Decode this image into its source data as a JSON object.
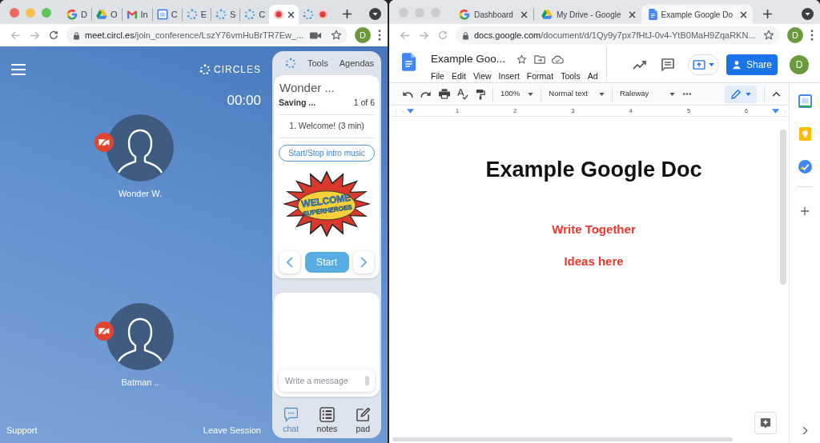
{
  "left_window": {
    "focused": true,
    "compact_tabs": true,
    "tabs": [
      {
        "kind": "google",
        "label": "D",
        "selected": false
      },
      {
        "kind": "drive",
        "label": "O",
        "selected": false
      },
      {
        "kind": "gmail",
        "label": "In",
        "selected": false
      },
      {
        "kind": "calendar",
        "label": "C",
        "selected": false
      },
      {
        "kind": "circles",
        "label": "E",
        "selected": false
      },
      {
        "kind": "circles",
        "label": "S",
        "selected": false
      },
      {
        "kind": "circles",
        "label": "C",
        "selected": false
      },
      {
        "kind": "recording",
        "selected": true
      },
      {
        "kind": "circles_recording",
        "selected": false
      }
    ],
    "address_bar": {
      "host": "meet.circl.es",
      "path": "/join_conference/LszY76vmHuBrTR7Ew_...",
      "camera_in_use": true,
      "avatar": "D"
    },
    "conference": {
      "logo": "CIRCLES",
      "timer": "00:00",
      "participants": [
        {
          "name": "Wonder W.",
          "camera_off": true
        },
        {
          "name": "Batman ..",
          "camera_off": true
        }
      ],
      "footer": [
        "Support",
        "Leave Session"
      ]
    },
    "circles_panel": {
      "nav": [
        "Tools",
        "Agendas"
      ],
      "agenda": {
        "title": "Wonder ...",
        "status": "Saving ...",
        "position": "1 of 6",
        "item": "1. Welcome! (3 min)",
        "music_button": "Start/Stop intro music",
        "banner": [
          "WELCOME",
          "SUPERHEROES"
        ],
        "start_button": "Start"
      },
      "chat": {
        "placeholder": "Write a message"
      },
      "bottom_tabs": [
        {
          "kind": "chat",
          "label": "chat",
          "selected": true
        },
        {
          "kind": "notes",
          "label": "notes",
          "selected": false
        },
        {
          "kind": "pad",
          "label": "pad",
          "selected": false
        }
      ]
    }
  },
  "right_window": {
    "focused": false,
    "tabs": [
      {
        "kind": "google",
        "label": "Dashboard",
        "selected": false
      },
      {
        "kind": "drive",
        "label": "My Drive - Google",
        "selected": false
      },
      {
        "kind": "docs",
        "label": "Example Google Do",
        "selected": true
      }
    ],
    "address_bar": {
      "host": "docs.google.com",
      "path": "/document/d/1Qy9y7px7fHtJ-0v4-YtB0MaH9ZqaRKN...",
      "avatar": "D"
    },
    "docs": {
      "title": "Example Goo...",
      "menu": [
        "File",
        "Edit",
        "View",
        "Insert",
        "Format",
        "Tools",
        "Ad"
      ],
      "share_button": "Share",
      "avatar": "D",
      "toolbar": {
        "zoom": "100%",
        "style": "Normal text",
        "font": "Raleway"
      },
      "ruler": [
        "1",
        "2",
        "3",
        "4",
        "5",
        "6"
      ],
      "document": {
        "heading": "Example Google Doc",
        "lines": [
          "Write Together",
          "Ideas here"
        ]
      }
    }
  }
}
